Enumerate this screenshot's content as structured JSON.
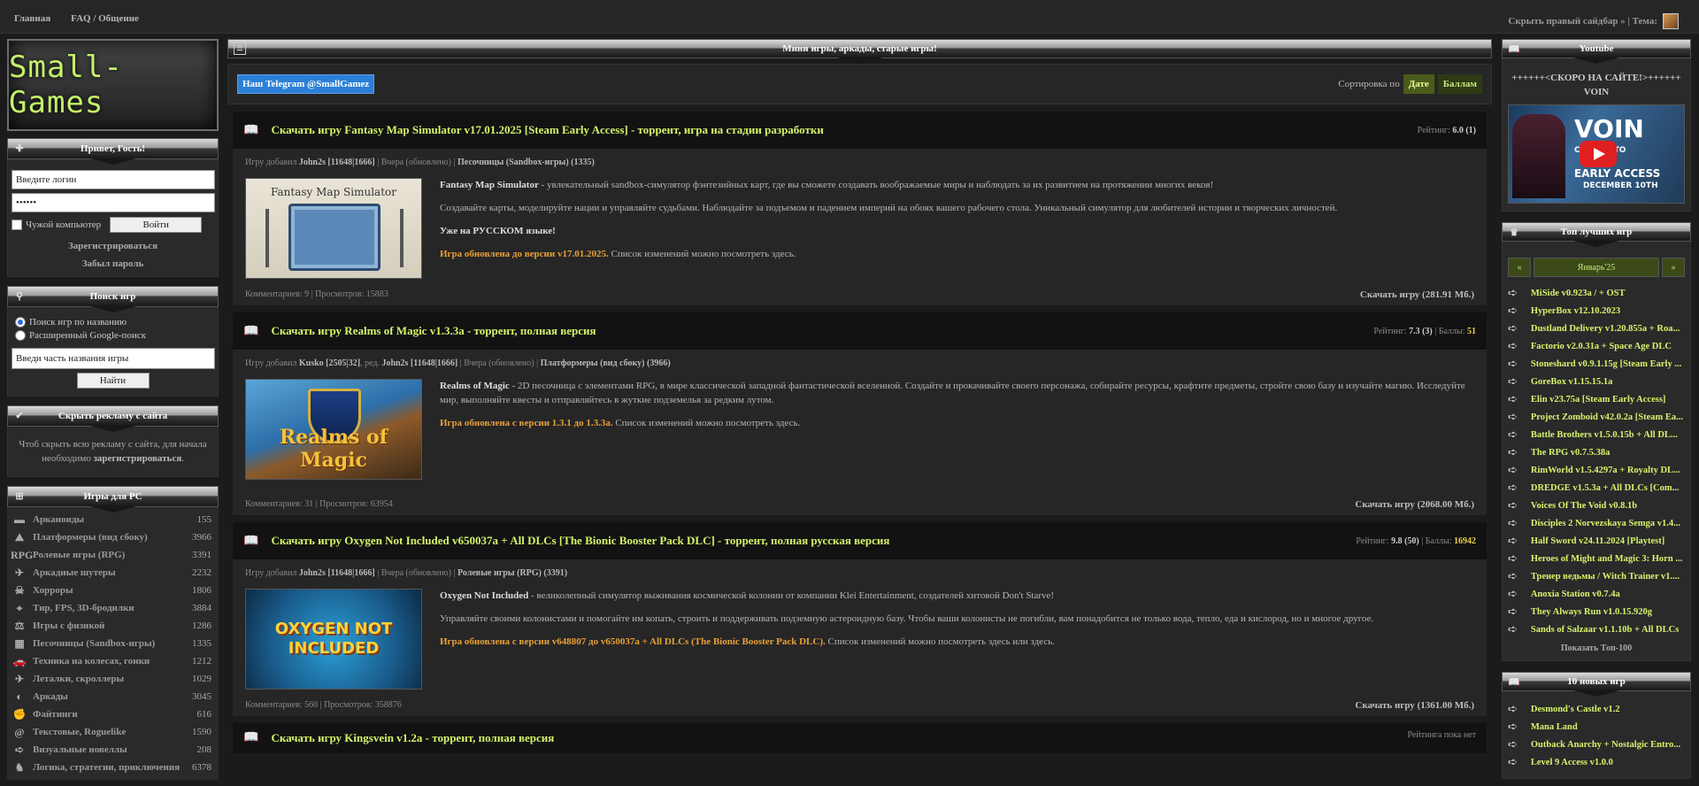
{
  "topnav": {
    "home": "Главная",
    "faq": "FAQ / Общение"
  },
  "topright": {
    "hide_sidebar": "Скрыть правый сайдбар » | Тема:"
  },
  "logo": {
    "text": "Small-Games"
  },
  "login": {
    "header": "Привет, Гость!",
    "login_placeholder": "Введите логин",
    "password_value": "••••••",
    "foreign_pc": "Чужой компьютер",
    "submit": "Войти",
    "register": "Зарегистрироваться",
    "forgot": "Забыл пароль"
  },
  "search": {
    "header": "Поиск игр",
    "opt_name": "Поиск игр по названию",
    "opt_google": "Расширенный Google-поиск",
    "placeholder": "Введи часть названия игры",
    "submit": "Найти"
  },
  "ads": {
    "header": "Скрыть рекламу с сайта",
    "text1": "Чтоб скрыть всю рекламу с сайта, для начала необходимо ",
    "link": "зарегистрироваться",
    "text2": "."
  },
  "categories": {
    "header": "Игры для PC",
    "items": [
      {
        "icon": "▬",
        "name": "Арканоиды",
        "count": "155"
      },
      {
        "icon": "⛰",
        "name": "Платформеры (вид сбоку)",
        "count": "3966"
      },
      {
        "icon": "RPG",
        "name": "Ролевые игры (RPG)",
        "count": "3391"
      },
      {
        "icon": "✈",
        "name": "Аркадные шутеры",
        "count": "2232"
      },
      {
        "icon": "☠",
        "name": "Хорроры",
        "count": "1806"
      },
      {
        "icon": "⌖",
        "name": "Тир, FPS, 3D-бродилки",
        "count": "3884"
      },
      {
        "icon": "⚖",
        "name": "Игры с физикой",
        "count": "1286"
      },
      {
        "icon": "▦",
        "name": "Песочницы (Sandbox-игры)",
        "count": "1335"
      },
      {
        "icon": "🚗",
        "name": "Техника на колесах, гонки",
        "count": "1212"
      },
      {
        "icon": "✈",
        "name": "Леталки, скроллеры",
        "count": "1029"
      },
      {
        "icon": "◐",
        "name": "Аркады",
        "count": "3045"
      },
      {
        "icon": "✊",
        "name": "Файтинги",
        "count": "616"
      },
      {
        "icon": "@",
        "name": "Текстовые, Roguelike",
        "count": "1590"
      },
      {
        "icon": "➪",
        "name": "Визуальные новеллы",
        "count": "208"
      },
      {
        "icon": "♞",
        "name": "Логика, стратегии, приключения",
        "count": "6378"
      }
    ]
  },
  "main": {
    "header": "Мини игры, аркады, старые игры!",
    "telegram": "Наш Telegram @SmallGamez",
    "sort_label": "Сортировка по",
    "sort_date": "Дате",
    "sort_score": "Баллам"
  },
  "posts": [
    {
      "title": "Скачать игру Fantasy Map Simulator v17.01.2025 [Steam Early Access] - торрент, игра на стадии разработки",
      "rating_label": "Рейтинг:",
      "rating": "6.0 (1)",
      "points_label": "",
      "points": "",
      "meta_prefix": "Игру добавил",
      "author": "John2s [11648|1666]",
      "editor_prefix": "",
      "editor": "",
      "meta_mid": " | Вчера (обновлено) | ",
      "category": "Песочницы (Sandbox-игры) (1335)",
      "image_caption": "Fantasy Map Simulator",
      "desc_lead": "Fantasy Map Simulator",
      "desc": " - увлекательный sandbox-симулятор фэнтезийных карт, где вы сможете создавать воображаемые миры и наблюдать за их развитием на протяжении многих веков!",
      "p2": "Создавайте карты, моделируйте нации и управляйте судьбами. Наблюдайте за подъемом и падением империй на обоях вашего рабочего стола. Уникальный симулятор для любителей истории и творческих личностей.",
      "p3": "Уже на РУССКОМ языке!",
      "update": "Игра обновлена до версии v17.01.2025.",
      "update_tail": " Список изменений можно посмотреть здесь.",
      "comments": "Комментариев: 9 | Просмотров: 15883",
      "download": "Скачать игру (281.91 Мб.)"
    },
    {
      "title": "Скачать игру Realms of Magic v1.3.3a - торрент, полная версия",
      "rating_label": "Рейтинг:",
      "rating": "7.3 (3)",
      "points_label": " | Баллы:",
      "points": "51",
      "meta_prefix": "Игру добавил",
      "author": "Kusko [2505|32]",
      "editor_prefix": ", ред. ",
      "editor": "John2s [11648|1666]",
      "meta_mid": " | Вчера (обновлено) | ",
      "category": "Платформеры (вид сбоку) (3966)",
      "image_caption": "Realms of Magic",
      "desc_lead": "Realms of Magic",
      "desc": " - 2D песочница с элементами RPG, в мире классической западной фантастической вселенной. Создайте и прокачивайте своего персонажа, собирайте ресурсы, крафтите предметы, стройте свою базу и изучайте магию. Исследуйте мир, выполняйте квесты и отправляйтесь в жуткие подземелья за редким лутом.",
      "p2": "",
      "p3": "",
      "update": "Игра обновлена с версии 1.3.1 до 1.3.3a.",
      "update_tail": " Список изменений можно посмотреть здесь.",
      "comments": "Комментариев: 31 | Просмотров: 63954",
      "download": "Скачать игру (2068.00 Мб.)"
    },
    {
      "title": "Скачать игру Oxygen Not Included v650037a + All DLCs [The Bionic Booster Pack DLC] - торрент, полная русская версия",
      "rating_label": "Рейтинг:",
      "rating": "9.8 (50)",
      "points_label": " | Баллы:",
      "points": "16942",
      "meta_prefix": "Игру добавил",
      "author": "John2s [11648|1666]",
      "editor_prefix": "",
      "editor": "",
      "meta_mid": " | Вчера (обновлено) | ",
      "category": "Ролевые игры (RPG) (3391)",
      "image_caption": "OXYGEN NOT INCLUDED",
      "desc_lead": "Oxygen Not Included",
      "desc": " - великолепный симулятор выживания космической колонии от компании Klei Entertainment, создателей хитовой Don't Starve!",
      "p2": "Управляйте своими колонистами и помогайте им копать, строить и поддерживать подземную астероидную базу. Чтобы ваши колонисты не погибли, вам понадобится не только вода, тепло, еда и кислород, но и многое другое.",
      "p3": "",
      "update": "Игра обновлена с версии v648807 до v650037a + All DLCs (The Bionic Booster Pack DLC).",
      "update_tail": " Список изменений можно посмотреть здесь или здесь.",
      "comments": "Комментариев: 560 | Просмотров: 358876",
      "download": "Скачать игру (1361.00 Мб.)"
    },
    {
      "title": "Скачать игру Kingsvein v1.2a - торрент, полная версия",
      "rating_label": "Рейтинга пока нет",
      "rating": "",
      "points_label": "",
      "points": ""
    }
  ],
  "youtube": {
    "header": "Youtube",
    "line1": "++++++<СКОРО НА САЙТЕ!>++++++",
    "line2": "VOIN",
    "thumb_title": "VOIN",
    "thumb_sub1": "COMING TO",
    "thumb_sub2": "EARLY ACCESS",
    "thumb_sub3": "DECEMBER 10TH"
  },
  "top": {
    "header": "Топ лучших игр",
    "prev": "«",
    "month": "Январь'25",
    "next": "»",
    "items": [
      "MiSide v0.923a / + OST",
      "HyperBox v12.10.2023",
      "Dustland Delivery v1.20.855a + Roa...",
      "Factorio v2.0.31a + Space Age DLC",
      "Stoneshard v0.9.1.15g [Steam Early ...",
      "GoreBox v1.15.15.1a",
      "Elin v23.75a [Steam Early Access]",
      "Project Zomboid v42.0.2a [Steam Ea...",
      "Battle Brothers v1.5.0.15b + All DL...",
      "The RPG v0.7.5.38a",
      "RimWorld v1.5.4297a + Royalty DL...",
      "DREDGE v1.5.3a + All DLCs [Com...",
      "Voices Of The Void v0.8.1b",
      "Disciples 2 Norvezskaya Semga v1.4...",
      "Half Sword v24.11.2024 [Playtest]",
      "Heroes of Might and Magic 3: Horn ...",
      "Тренер ведьмы / Witch Trainer v1....",
      "Anoxia Station v0.7.4a",
      "They Always Run v1.0.15.920g",
      "Sands of Salzaar v1.1.10b + All DLCs"
    ],
    "show_all": "Показать Топ-100"
  },
  "newgames": {
    "header": "10 новых игр",
    "items": [
      "Desmond's Castle v1.2",
      "Mana Land",
      "Outback Anarchy + Nostalgic Entro...",
      "Level 9 Access v1.0.0"
    ]
  }
}
